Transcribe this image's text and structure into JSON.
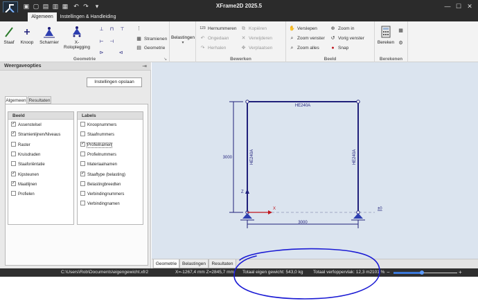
{
  "app": {
    "title": "XFrame2D 2025.5"
  },
  "quick_access": [
    "save-icon",
    "new-icon",
    "open-icon",
    "undo-icon",
    "redo-icon",
    "dropdown-icon"
  ],
  "tabs": [
    {
      "label": "Algemeen",
      "active": true
    },
    {
      "label": "Instellingen & Handleiding",
      "active": false
    }
  ],
  "ribbon": {
    "geometrie": {
      "label": "Geometrie",
      "staaf": "Staaf",
      "knoop": "Knoop",
      "scharnier": "Scharnier",
      "roloplegging": "X-Roloplegging",
      "stramienen": "Stramienen",
      "geometrie_btn": "Geometrie"
    },
    "belastingen": {
      "label": "Belastingen"
    },
    "bewerken": {
      "label": "Bewerken",
      "hernummeren": "Hernummeren",
      "ongedaan": "Ongedaan",
      "herhalen": "Herhalen",
      "kopieren": "Kopiëren",
      "verwijderen": "Verwijderen",
      "verplaatsen": "Verplaatsen"
    },
    "beeld": {
      "label": "Beeld",
      "verslepen": "Verslepen",
      "zoom_venster": "Zoom venster",
      "zoom_alles": "Zoom alles",
      "zoom_in": "Zoom in",
      "vorig_venster": "Vorig venster",
      "snap": "Snap"
    },
    "berekenen": {
      "label": "Berekenen",
      "bereken": "Bereken"
    }
  },
  "panel": {
    "title": "Weergaveopties",
    "save_button": "Instellingen opslaan",
    "tabs": [
      "Algemeen",
      "Resultaten"
    ],
    "beeld": {
      "header": "Beeld",
      "items": [
        {
          "label": "Assenstelsel",
          "checked": true
        },
        {
          "label": "Stramienlijnen/Niveaus",
          "checked": true
        },
        {
          "label": "Raster",
          "checked": false
        },
        {
          "label": "Kruisdraden",
          "checked": false
        },
        {
          "label": "Staaforiëntatie",
          "checked": false
        },
        {
          "label": "Kipsteunen",
          "checked": true
        },
        {
          "label": "Maatlijnen",
          "checked": true
        },
        {
          "label": "Profielen",
          "checked": false
        }
      ]
    },
    "labels": {
      "header": "Labels",
      "items": [
        {
          "label": "Knoopnummers",
          "checked": false
        },
        {
          "label": "Staafnummers",
          "checked": false
        },
        {
          "label": "Profielnamen",
          "checked": true
        },
        {
          "label": "Profielnummers",
          "checked": false
        },
        {
          "label": "Materiaalnamen",
          "checked": false
        },
        {
          "label": "Staaftype (belasting)",
          "checked": true
        },
        {
          "label": "Belastingbreedten",
          "checked": false
        },
        {
          "label": "Verbindingnummers",
          "checked": false
        },
        {
          "label": "Verbindingnamen",
          "checked": false
        }
      ]
    }
  },
  "canvas": {
    "beam_label": "HE240A",
    "left_column_label": "HE240A",
    "right_column_label": "HE240A",
    "height_dim": "3000",
    "width_dim": "3000",
    "axis_x": "X",
    "axis_z": "Z",
    "level": "±0",
    "accent": "#1f1f7a",
    "axis_x_color": "#c0141c"
  },
  "bottom_tabs": [
    "Geometrie",
    "Belastingen",
    "Resultaten"
  ],
  "status": {
    "file": "C:\\Users\\Rob\\Documents\\eigengewicht.xfr2",
    "coords": "X=-1267,4 mm  Z=2845,7 mm",
    "weight": "Totaal eigen gewicht:  543,0 kg",
    "area": "Totaal verfoppervlak:  12,3 m2",
    "zoom": "101 %",
    "zoom_level": 0.45
  },
  "annotation_color": "#1a1ad4"
}
